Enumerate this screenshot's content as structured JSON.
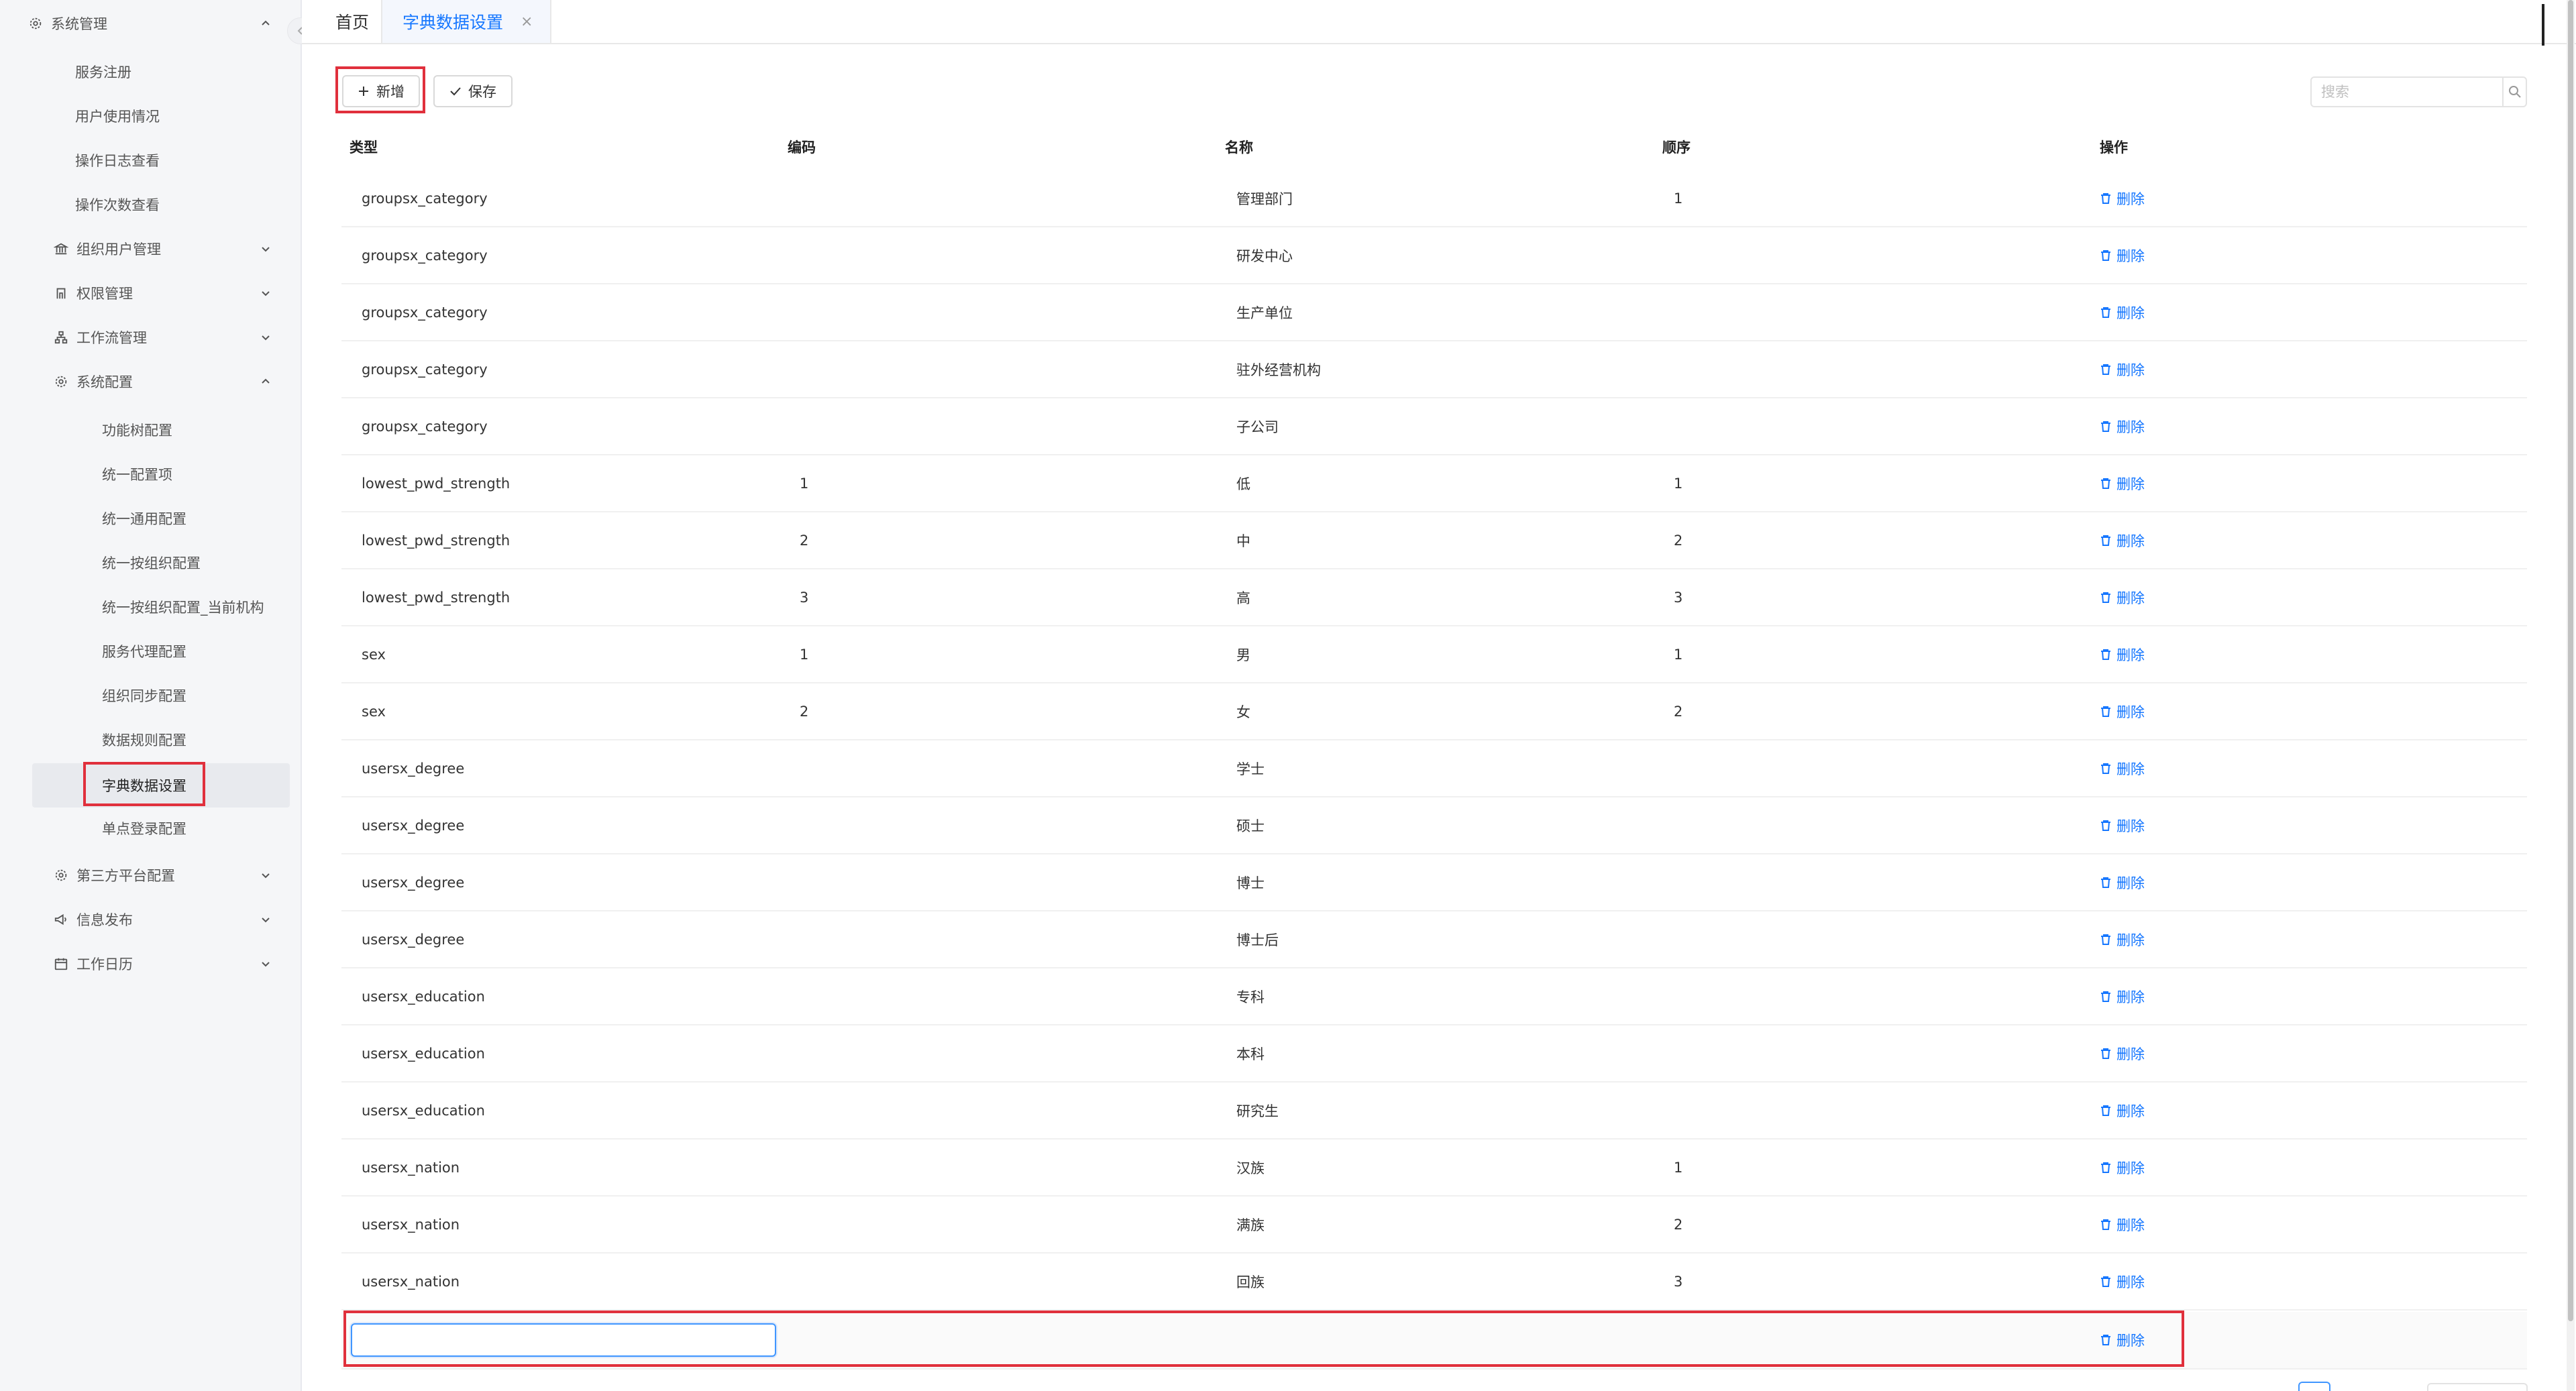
{
  "sidebar": {
    "system_management": "系统管理",
    "sub_items": [
      "服务注册",
      "用户使用情况",
      "操作日志查看",
      "操作次数查看"
    ],
    "org_user_management": "组织用户管理",
    "permission_management": "权限管理",
    "workflow_management": "工作流管理",
    "system_config": "系统配置",
    "config_items": [
      "功能树配置",
      "统一配置项",
      "统一通用配置",
      "统一按组织配置",
      "统一按组织配置_当前机构",
      "服务代理配置",
      "组织同步配置",
      "数据规则配置",
      "字典数据设置",
      "单点登录配置"
    ],
    "third_party_config": "第三方平台配置",
    "info_publish": "信息发布",
    "work_calendar": "工作日历"
  },
  "tabs": {
    "home": "首页",
    "dict_settings": "字典数据设置",
    "close_symbol": "×"
  },
  "toolbar": {
    "add_label": "新增",
    "save_label": "保存",
    "search_placeholder": "搜索"
  },
  "table": {
    "headers": {
      "type": "类型",
      "code": "编码",
      "name": "名称",
      "order": "顺序",
      "action": "操作"
    },
    "delete_label": "删除",
    "rows": [
      {
        "type": "groupsx_category",
        "code": "",
        "name": "管理部门",
        "order": "1"
      },
      {
        "type": "groupsx_category",
        "code": "",
        "name": "研发中心",
        "order": ""
      },
      {
        "type": "groupsx_category",
        "code": "",
        "name": "生产单位",
        "order": ""
      },
      {
        "type": "groupsx_category",
        "code": "",
        "name": "驻外经营机构",
        "order": ""
      },
      {
        "type": "groupsx_category",
        "code": "",
        "name": "子公司",
        "order": ""
      },
      {
        "type": "lowest_pwd_strength",
        "code": "1",
        "name": "低",
        "order": "1"
      },
      {
        "type": "lowest_pwd_strength",
        "code": "2",
        "name": "中",
        "order": "2"
      },
      {
        "type": "lowest_pwd_strength",
        "code": "3",
        "name": "高",
        "order": "3"
      },
      {
        "type": "sex",
        "code": "1",
        "name": "男",
        "order": "1"
      },
      {
        "type": "sex",
        "code": "2",
        "name": "女",
        "order": "2"
      },
      {
        "type": "usersx_degree",
        "code": "",
        "name": "学士",
        "order": ""
      },
      {
        "type": "usersx_degree",
        "code": "",
        "name": "硕士",
        "order": ""
      },
      {
        "type": "usersx_degree",
        "code": "",
        "name": "博士",
        "order": ""
      },
      {
        "type": "usersx_degree",
        "code": "",
        "name": "博士后",
        "order": ""
      },
      {
        "type": "usersx_education",
        "code": "",
        "name": "专科",
        "order": ""
      },
      {
        "type": "usersx_education",
        "code": "",
        "name": "本科",
        "order": ""
      },
      {
        "type": "usersx_education",
        "code": "",
        "name": "研究生",
        "order": ""
      },
      {
        "type": "usersx_nation",
        "code": "",
        "name": "汉族",
        "order": "1"
      },
      {
        "type": "usersx_nation",
        "code": "",
        "name": "满族",
        "order": "2"
      },
      {
        "type": "usersx_nation",
        "code": "",
        "name": "回族",
        "order": "3"
      }
    ],
    "new_row_value": ""
  },
  "colors": {
    "accent": "#1677ff",
    "highlight": "#e0303c"
  }
}
